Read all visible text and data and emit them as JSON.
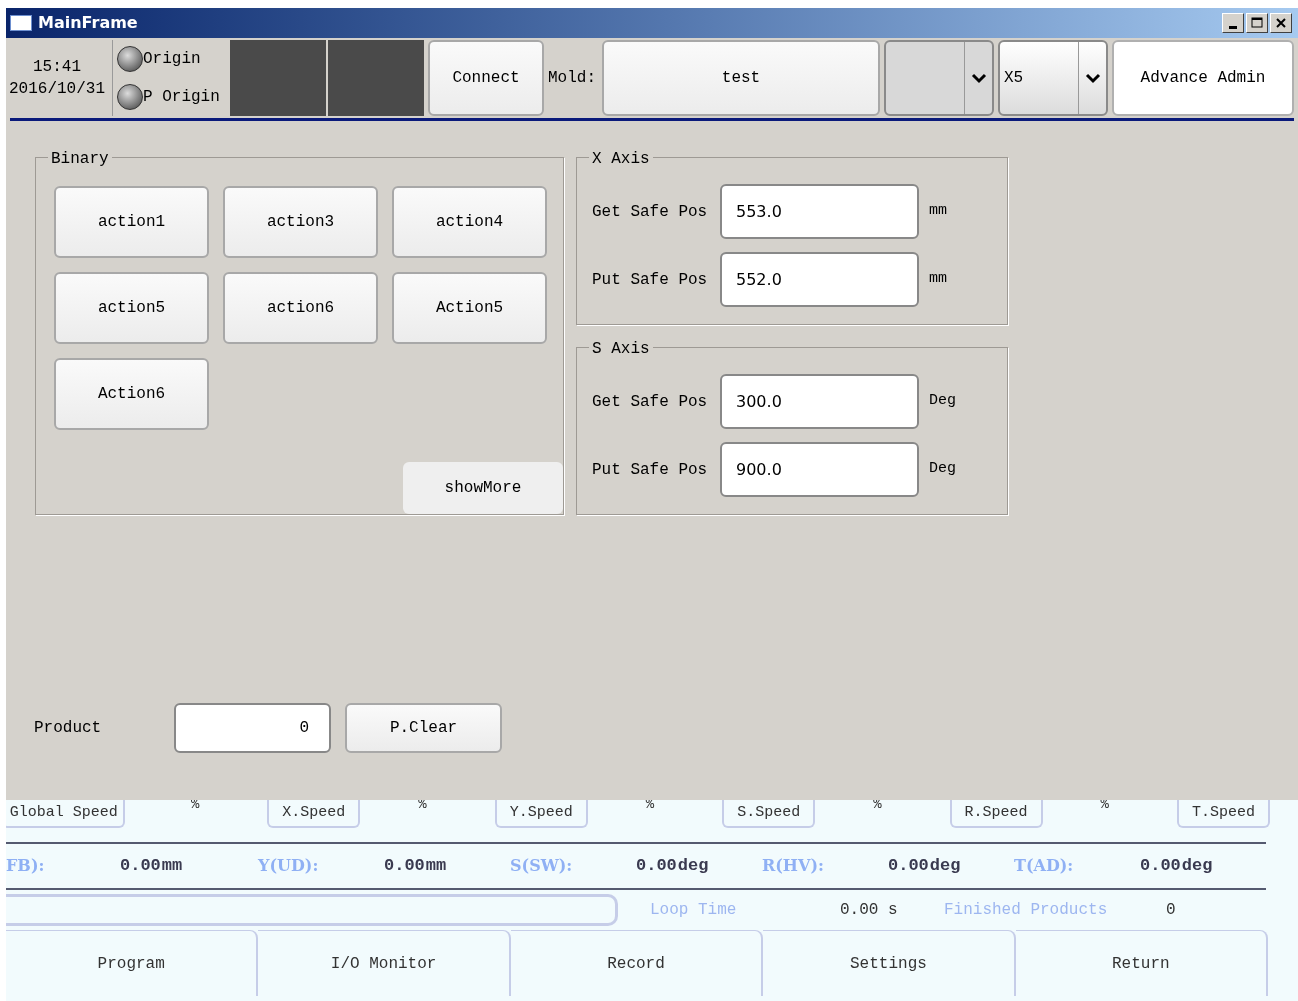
{
  "window": {
    "title": "MainFrame"
  },
  "toolbar": {
    "time": "15:41",
    "date": "2016/10/31",
    "indicators": [
      {
        "label": "Origin",
        "on": false
      },
      {
        "label": "P Origin",
        "on": false
      }
    ],
    "connect_button": "Connect",
    "mold_label": "Mold:",
    "mold_value": "test",
    "speed_combo": "X5",
    "user_button": "Advance Admin"
  },
  "binary": {
    "title": "Binary",
    "actions": [
      "action1",
      "action3",
      "action4",
      "action5",
      "action6",
      "Action5",
      "Action6"
    ],
    "show_more": "showMore"
  },
  "axes": [
    {
      "title": "X Axis",
      "fields": [
        {
          "label": "Get Safe Pos",
          "value": "553.0",
          "unit": "mm"
        },
        {
          "label": "Put Safe Pos",
          "value": "552.0",
          "unit": "mm"
        }
      ]
    },
    {
      "title": "S Axis",
      "fields": [
        {
          "label": "Get Safe Pos",
          "value": "300.0",
          "unit": "Deg"
        },
        {
          "label": "Put Safe Pos",
          "value": "900.0",
          "unit": "Deg"
        }
      ]
    }
  ],
  "product": {
    "label": "Product",
    "value": "0",
    "clear_button": "P.Clear"
  },
  "speeds": [
    {
      "label": "Global Speed"
    },
    {
      "label": "X.Speed",
      "unit": "%"
    },
    {
      "label": "Y.Speed",
      "unit": "%"
    },
    {
      "label": "S.Speed",
      "unit": "%"
    },
    {
      "label": "R.Speed",
      "unit": "%"
    },
    {
      "label": "T.Speed",
      "unit": "%"
    }
  ],
  "readings": [
    {
      "label": "FB):",
      "value": "0.00",
      "unit": "mm"
    },
    {
      "label": "Y(UD):",
      "value": "0.00",
      "unit": "mm"
    },
    {
      "label": "S(SW):",
      "value": "0.00",
      "unit": "deg"
    },
    {
      "label": "R(HV):",
      "value": "0.00",
      "unit": "deg"
    },
    {
      "label": "T(AD):",
      "value": "0.00",
      "unit": "deg"
    }
  ],
  "loop_time": {
    "label": "Loop Time",
    "value": "0.00 s"
  },
  "finished_products": {
    "label": "Finished Products",
    "value": "0"
  },
  "nav": [
    "Program",
    "I/O Monitor",
    "Record",
    "Settings",
    "Return"
  ]
}
